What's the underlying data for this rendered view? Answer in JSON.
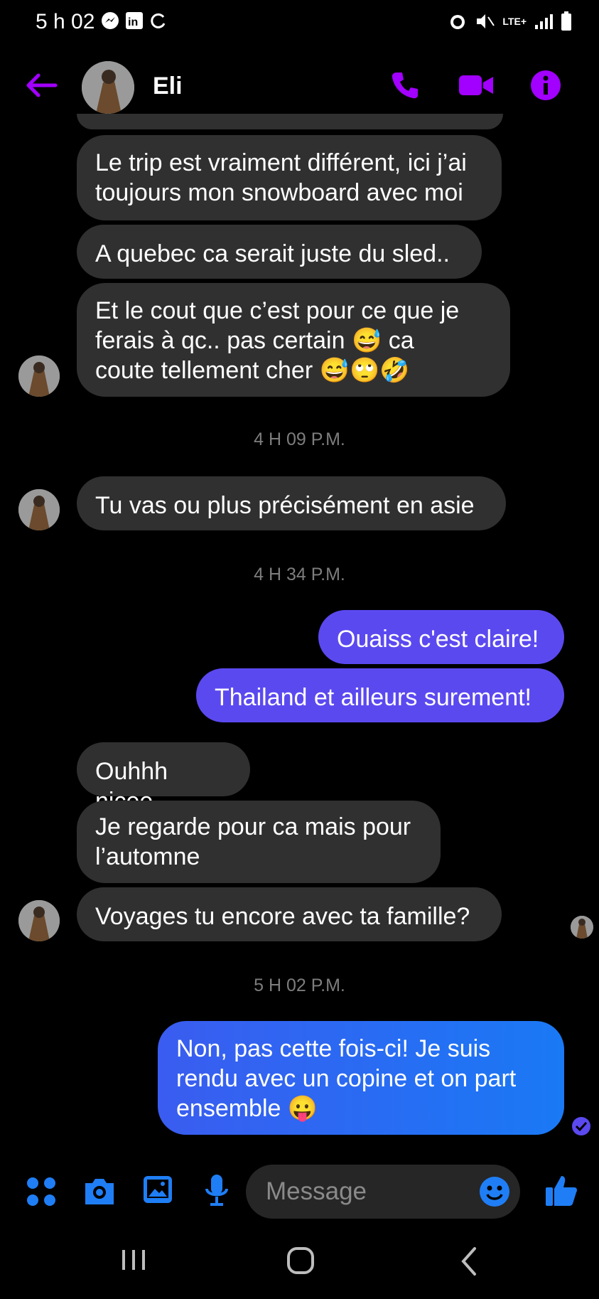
{
  "status_bar": {
    "time": "5 h 02",
    "network": "LTE+"
  },
  "header": {
    "contact_name": "Eli"
  },
  "conversation": {
    "incoming_group_1": [
      "Le trip est vraiment différent, ici j’ai\ntoujours mon snowboard avec moi",
      "A quebec ca serait juste du sled..",
      "Et le cout que c’est pour ce que je\nferais à qc.. pas certain 😅 ca\ncoute tellement cher 😅🙄🤣"
    ],
    "timestamp_1": "4 H 09 P.M.",
    "incoming_2": "Tu vas ou plus précisément en asie",
    "timestamp_2": "4 H 34 P.M.",
    "outgoing_1": [
      "Ouaiss c'est claire!",
      "Thailand et ailleurs surement!"
    ],
    "incoming_group_3": [
      "Ouhhh nicee",
      "Je regarde pour ca mais pour\nl’automne",
      "Voyages tu encore avec ta famille?"
    ],
    "timestamp_3": "5 H 02 P.M.",
    "outgoing_2": "Non, pas cette fois-ci! Je suis\nrendu avec un copine et on part\nensemble 😛"
  },
  "composer": {
    "placeholder": "Message"
  },
  "icons": [
    "back-arrow-icon",
    "phone-icon",
    "video-icon",
    "info-icon",
    "menu-dots-icon",
    "camera-icon",
    "gallery-icon",
    "mic-icon",
    "emoji-icon",
    "like-icon",
    "recents-icon",
    "home-icon",
    "back-icon",
    "seen-check-icon"
  ],
  "colors": {
    "accent_purple": "#a200ff",
    "composer_blue": "#1f7ef5",
    "bubble_dark": "#303030",
    "bubble_me": "#5b49f0"
  }
}
